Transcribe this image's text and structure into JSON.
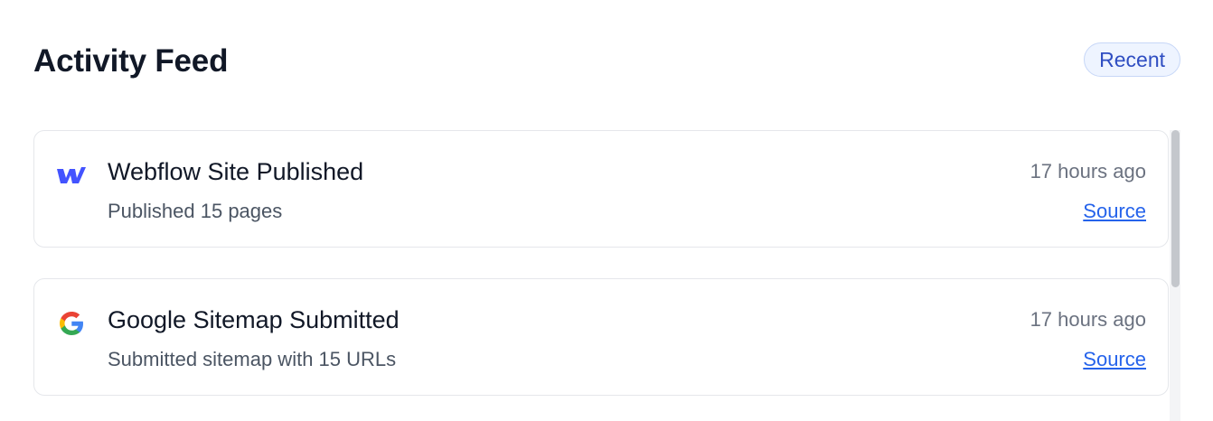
{
  "header": {
    "title": "Activity Feed",
    "badge": "Recent"
  },
  "feed": {
    "items": [
      {
        "icon": "webflow-icon",
        "title": "Webflow Site Published",
        "subtitle": "Published 15 pages",
        "time": "17 hours ago",
        "link": "Source"
      },
      {
        "icon": "google-icon",
        "title": "Google Sitemap Submitted",
        "subtitle": "Submitted sitemap with 15 URLs",
        "time": "17 hours ago",
        "link": "Source"
      }
    ]
  },
  "colors": {
    "accent": "#2563eb",
    "badge_text": "#2f4ec2",
    "badge_bg": "#eef4ff",
    "webflow_blue": "#4353ff"
  }
}
